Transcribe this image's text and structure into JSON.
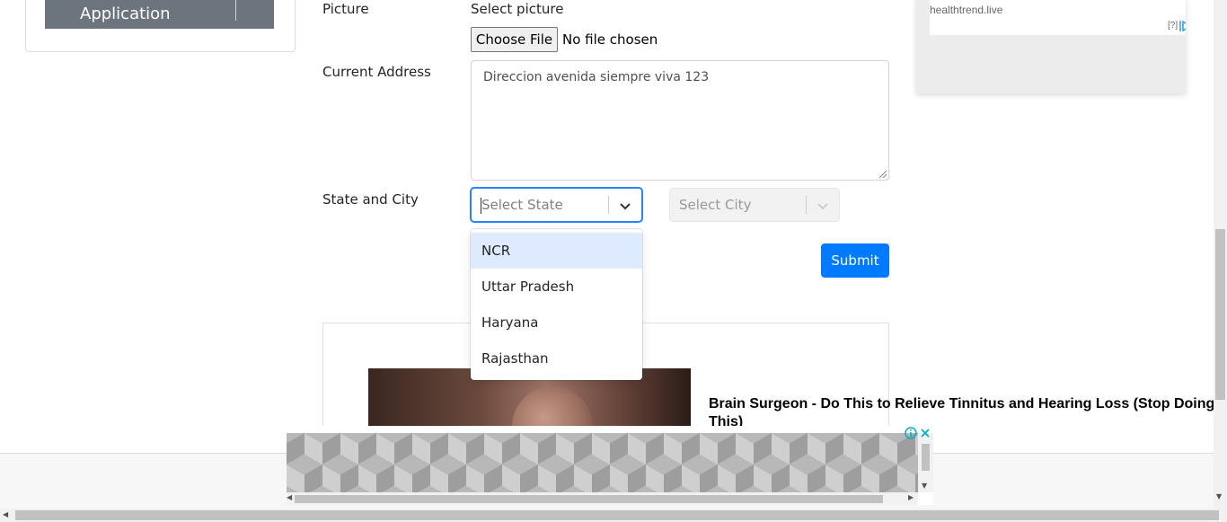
{
  "sidebar": {
    "active_item": {
      "label": "Book Store Application",
      "icon": "book-icon",
      "action_icon": "download-icon"
    }
  },
  "form": {
    "picture": {
      "label": "Picture",
      "sublabel": "Select picture",
      "button_label": "Choose File",
      "status": "No file chosen"
    },
    "address": {
      "label": "Current Address",
      "value": "Direccion avenida siempre viva 123"
    },
    "state_city": {
      "label": "State and City",
      "state_placeholder": "Select State",
      "city_placeholder": "Select City",
      "state_options": [
        "NCR",
        "Uttar Pradesh",
        "Haryana",
        "Rajasthan"
      ],
      "highlighted_option": "NCR"
    },
    "submit_label": "Submit"
  },
  "ads": {
    "top_right": {
      "domain": "healthtrend.live",
      "help": "[?]"
    },
    "content": {
      "headline": "Brain Surgeon - Do This to Relieve Tinnitus and Hearing Loss (Stop Doing This)"
    }
  },
  "colors": {
    "primary": "#007bff",
    "focus_border": "#2684ff",
    "option_highlight": "#deebff",
    "sidebar_item": "#6c757d"
  }
}
